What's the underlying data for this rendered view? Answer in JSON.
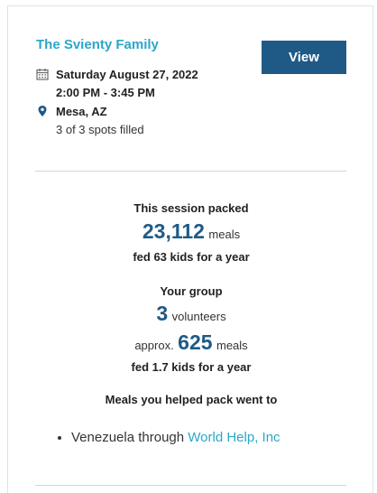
{
  "event": {
    "title": "The Svienty Family",
    "view_label": "View",
    "date": "Saturday August 27, 2022",
    "time": "2:00 PM - 3:45 PM",
    "location": "Mesa, AZ",
    "spots": "3 of 3 spots filled"
  },
  "session": {
    "heading": "This session packed",
    "meals_count": "23,112",
    "meals_unit": "meals",
    "fed_text": "fed 63 kids for a year"
  },
  "group": {
    "heading": "Your group",
    "volunteers_count": "3",
    "volunteers_unit": "volunteers",
    "approx_label": "approx.",
    "meals_count": "625",
    "meals_unit": "meals",
    "fed_text": "fed 1.7 kids for a year"
  },
  "destination": {
    "heading": "Meals you helped pack went to",
    "items": [
      {
        "text": "Venezuela through",
        "link_text": "World Help, Inc"
      }
    ]
  },
  "colors": {
    "accent": "#2aa7c9",
    "primary": "#1f5a87"
  },
  "icons": {
    "date": "calendar-icon",
    "location": "map-pin-icon"
  }
}
